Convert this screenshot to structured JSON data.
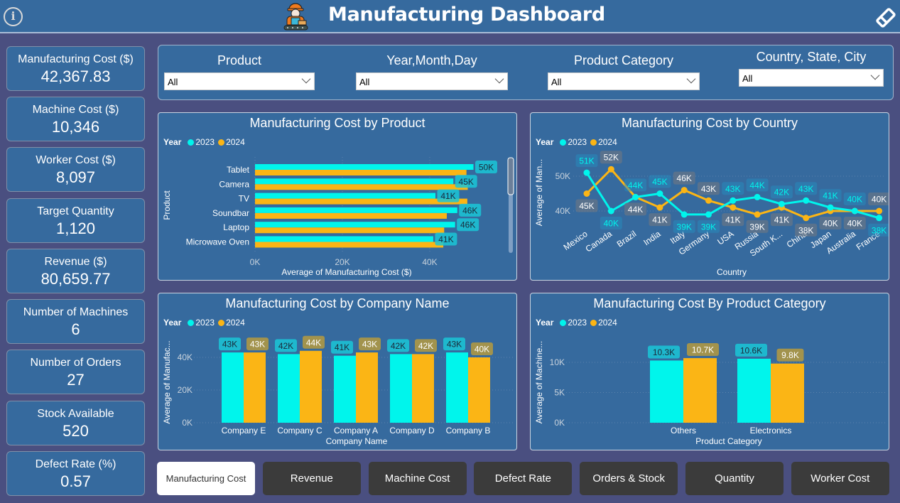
{
  "header": {
    "title": "Manufacturing Dashboard",
    "icons": [
      "info-icon",
      "worker-icon",
      "eraser-icon"
    ]
  },
  "kpis": [
    {
      "label": "Manufacturing Cost ($)",
      "value": "42,367.83"
    },
    {
      "label": "Machine Cost ($)",
      "value": "10,346"
    },
    {
      "label": "Worker Cost ($)",
      "value": "8,097"
    },
    {
      "label": "Target Quantity",
      "value": "1,120"
    },
    {
      "label": "Revenue ($)",
      "value": "80,659.77"
    },
    {
      "label": "Number of Machines",
      "value": "6"
    },
    {
      "label": "Number of Orders",
      "value": "27"
    },
    {
      "label": "Stock Available",
      "value": "520"
    },
    {
      "label": "Defect Rate (%)",
      "value": "0.57"
    }
  ],
  "filters": [
    {
      "label": "Product",
      "value": "All"
    },
    {
      "label": "Year,Month,Day",
      "value": "All"
    },
    {
      "label": "Product Category",
      "value": "All"
    },
    {
      "label": "Country, State, City",
      "value": "All"
    }
  ],
  "colors": {
    "series_2023": "#00f5ec",
    "series_2024": "#fbb515",
    "card_bg": "#366a9e",
    "page_bg": "#4a4f80",
    "nav_bg": "#3b3b3b"
  },
  "legend": {
    "title": "Year",
    "items": [
      "2023",
      "2024"
    ]
  },
  "nav": {
    "active": "Manufacturing Cost",
    "buttons": [
      "Manufacturing Cost",
      "Revenue",
      "Machine Cost",
      "Defect Rate",
      "Orders & Stock",
      "Quantity",
      "Worker Cost"
    ]
  },
  "chart_data": [
    {
      "id": "product",
      "type": "bar",
      "orientation": "horizontal",
      "title": "Manufacturing Cost by Product",
      "xlabel": "Average of Manufacturing Cost ($)",
      "ylabel": "Product",
      "categories": [
        "Tablet",
        "Camera",
        "TV",
        "Soundbar",
        "Laptop",
        "Microwave Oven"
      ],
      "series": [
        {
          "name": "2023",
          "values": [
            50000,
            45400,
            41300,
            46300,
            45800,
            40800
          ],
          "labels": [
            "50K",
            "45K",
            "41K",
            "46K",
            "46K",
            "41K"
          ]
        },
        {
          "name": "2024",
          "values": [
            48400,
            48700,
            48600,
            43900,
            43300,
            43100
          ]
        }
      ],
      "xticks": [
        "0K",
        "20K",
        "40K"
      ],
      "xlim": [
        0,
        60000
      ],
      "grid": true,
      "legend": "top-left",
      "scrollbar": true
    },
    {
      "id": "country",
      "type": "line",
      "title": "Manufacturing Cost by Country",
      "xlabel": "Country",
      "ylabel": "Average of Man...",
      "categories": [
        "Mexico",
        "Canada",
        "Brazil",
        "India",
        "Italy",
        "Germany",
        "USA",
        "Russia",
        "South K...",
        "China",
        "Japan",
        "Australia",
        "France"
      ],
      "series": [
        {
          "name": "2023",
          "values": [
            51000,
            40000,
            44000,
            45000,
            39000,
            39000,
            43000,
            44000,
            42000,
            43000,
            41000,
            40000,
            38000
          ],
          "labels": [
            "51K",
            "40K",
            "44K",
            "45K",
            "39K",
            "39K",
            "43K",
            "44K",
            "42K",
            "43K",
            "41K",
            "40K",
            "38K"
          ]
        },
        {
          "name": "2024",
          "values": [
            45000,
            52000,
            44000,
            41000,
            46000,
            43000,
            41000,
            39000,
            41000,
            38000,
            40000,
            40000,
            40000
          ],
          "labels": [
            "45K",
            "52K",
            "44K",
            "41K",
            "46K",
            "43K",
            "41K",
            "39K",
            "41K",
            "38K",
            "40K",
            "40K",
            "40K"
          ]
        }
      ],
      "yticks": [
        "40K",
        "50K"
      ],
      "ylim": [
        35000,
        55000
      ],
      "grid": true,
      "legend": "top-left"
    },
    {
      "id": "company",
      "type": "bar",
      "orientation": "vertical",
      "title": "Manufacturing Cost by Company Name",
      "xlabel": "Company Name",
      "ylabel": "Average of Manufac...",
      "categories": [
        "Company E",
        "Company C",
        "Company A",
        "Company D",
        "Company B"
      ],
      "series": [
        {
          "name": "2023",
          "values": [
            43000,
            42000,
            41000,
            42000,
            43000
          ],
          "labels": [
            "43K",
            "42K",
            "41K",
            "42K",
            "43K"
          ]
        },
        {
          "name": "2024",
          "values": [
            43000,
            44000,
            43000,
            42000,
            40000
          ],
          "labels": [
            "43K",
            "44K",
            "43K",
            "42K",
            "40K"
          ]
        }
      ],
      "yticks": [
        "0K",
        "20K",
        "40K"
      ],
      "ylim": [
        0,
        55000
      ],
      "grid": true,
      "legend": "top-left"
    },
    {
      "id": "category",
      "type": "bar",
      "orientation": "vertical",
      "title": "Manufacturing Cost By Product Category",
      "xlabel": "Product Category",
      "ylabel": "Average of Machine...",
      "categories": [
        "Others",
        "Electronics"
      ],
      "series": [
        {
          "name": "2023",
          "values": [
            10300,
            10600
          ],
          "labels": [
            "10.3K",
            "10.6K"
          ]
        },
        {
          "name": "2024",
          "values": [
            10700,
            9800
          ],
          "labels": [
            "10.7K",
            "9.8K"
          ]
        }
      ],
      "yticks": [
        "0K",
        "5K",
        "10K"
      ],
      "ylim": [
        0,
        13500
      ],
      "grid": true,
      "legend": "top-left"
    }
  ]
}
